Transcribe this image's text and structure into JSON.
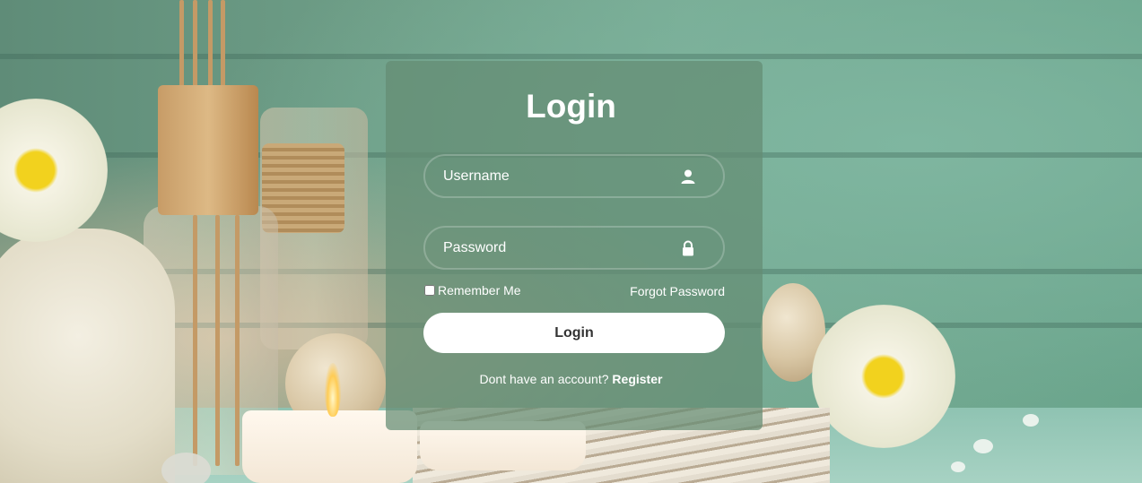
{
  "login_form": {
    "title": "Login",
    "username": {
      "placeholder": "Username",
      "value": "",
      "icon": "user-icon"
    },
    "password": {
      "placeholder": "Password",
      "value": "",
      "icon": "lock-icon"
    },
    "remember_label": "Remember Me",
    "forgot_label": "Forgot Password",
    "submit_label": "Login",
    "register_prompt": "Dont have an account?",
    "register_label": "Register"
  },
  "colors": {
    "card_overlay": "#648c73",
    "button_bg": "#ffffff",
    "button_text": "#333333",
    "text": "#ffffff"
  }
}
